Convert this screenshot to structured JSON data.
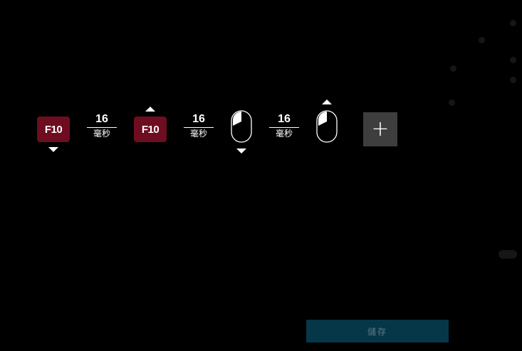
{
  "sequence": [
    {
      "type": "key",
      "label": "F10",
      "action": "down"
    },
    {
      "type": "delay",
      "value": "16",
      "unit": "毫秒"
    },
    {
      "type": "key",
      "label": "F10",
      "action": "up"
    },
    {
      "type": "delay",
      "value": "16",
      "unit": "毫秒"
    },
    {
      "type": "mouse",
      "button": "left",
      "action": "down"
    },
    {
      "type": "delay",
      "value": "16",
      "unit": "毫秒"
    },
    {
      "type": "mouse",
      "button": "left",
      "action": "up"
    }
  ],
  "add_button": {
    "label": "+",
    "icon": "plus-icon"
  },
  "save_button": {
    "label": "儲存"
  },
  "colors": {
    "background": "#000000",
    "key_fill": "#6e0d1f",
    "add_button_fill": "#3e3e3e",
    "save_button_fill": "#063749",
    "save_button_text": "#5e7a86"
  }
}
